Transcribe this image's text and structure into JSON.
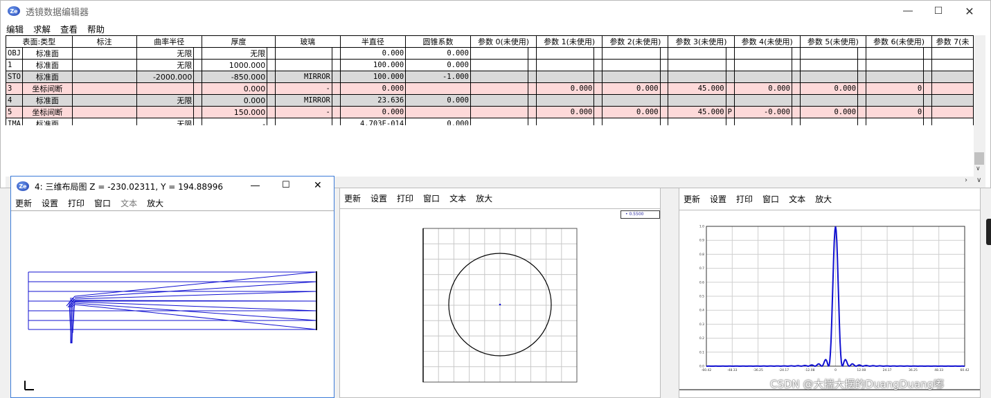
{
  "main": {
    "title": "透镜数据编辑器",
    "menu": [
      "编辑",
      "求解",
      "查看",
      "帮助"
    ],
    "columns": [
      "表面:类型",
      "标注",
      "曲率半径",
      "厚度",
      "玻璃",
      "半直径",
      "圆锥系数",
      "参数 0(未使用)",
      "参数 1(未使用)",
      "参数 2(未使用)",
      "参数 3(未使用)",
      "参数 4(未使用)",
      "参数 5(未使用)",
      "参数 6(未使用)",
      "参数 7(未"
    ],
    "rows": [
      {
        "id": "OBJ",
        "type": "标准面",
        "radius": "无限",
        "thickness": "无限",
        "glass": "",
        "semidia": "0.000",
        "conic": "0.000",
        "p1": "",
        "p2": "",
        "p3": "",
        "p4f": "",
        "p4": "",
        "p5": "",
        "p6": "",
        "style": ""
      },
      {
        "id": "1",
        "type": "标准面",
        "radius": "无限",
        "thickness": "1000.000",
        "glass": "",
        "semidia": "100.000",
        "conic": "0.000",
        "p1": "",
        "p2": "",
        "p3": "",
        "p4f": "",
        "p4": "",
        "p5": "",
        "p6": "",
        "style": ""
      },
      {
        "id": "STO",
        "type": "标准面",
        "radius": "-2000.000",
        "thickness": "-850.000",
        "glass": "MIRROR",
        "semidia": "100.000",
        "conic": "-1.000",
        "p1": "",
        "p2": "",
        "p3": "",
        "p4f": "",
        "p4": "",
        "p5": "",
        "p6": "",
        "style": "gray"
      },
      {
        "id": "3",
        "type": "坐标间断",
        "radius": "",
        "thickness": "0.000",
        "glass": "-",
        "semidia": "0.000",
        "conic": "",
        "p1": "0.000",
        "p2": "0.000",
        "p3": "45.000",
        "p4f": "",
        "p4": "0.000",
        "p5": "0.000",
        "p6": "0",
        "style": "pink"
      },
      {
        "id": "4",
        "type": "标准面",
        "radius": "无限",
        "thickness": "0.000",
        "glass": "MIRROR",
        "semidia": "23.636",
        "conic": "0.000",
        "p1": "",
        "p2": "",
        "p3": "",
        "p4f": "",
        "p4": "",
        "p5": "",
        "p6": "",
        "style": "gray"
      },
      {
        "id": "5",
        "type": "坐标间断",
        "radius": "",
        "thickness": "150.000",
        "glass": "-",
        "semidia": "0.000",
        "conic": "",
        "p1": "0.000",
        "p2": "0.000",
        "p3": "45.000",
        "p4f": "P",
        "p4": "-0.000",
        "p5": "0.000",
        "p6": "0",
        "style": "pink"
      },
      {
        "id": "IMA",
        "type": "标准面",
        "radius": "无限",
        "thickness": "-",
        "glass": "",
        "semidia": "4.703E-014",
        "conic": "0.000",
        "p1": "",
        "p2": "",
        "p3": "",
        "p4f": "",
        "p4": "",
        "p5": "",
        "p6": "",
        "style": ""
      }
    ]
  },
  "layout3d": {
    "title": "4: 三维布局图 Z = -230.02311, Y = 194.88996",
    "menu": [
      "更新",
      "设置",
      "打印",
      "窗口",
      "文本",
      "放大"
    ]
  },
  "spot": {
    "menu": [
      "更新",
      "设置",
      "打印",
      "窗口",
      "文本",
      "放大"
    ],
    "legend": "0.5500"
  },
  "psf": {
    "menu": [
      "更新",
      "设置",
      "打印",
      "窗口",
      "文本",
      "放大"
    ],
    "y_ticks": [
      "1.0",
      "0.9",
      "0.8",
      "0.7",
      "0.6",
      "0.5",
      "0.4",
      "0.3",
      "0.2",
      "0.1",
      "0.0"
    ],
    "x_ticks": [
      "-60.42",
      "-48.33",
      "-36.25",
      "-24.17",
      "-12.08",
      "0",
      "12.08",
      "24.17",
      "36.25",
      "48.33",
      "60.42"
    ]
  },
  "watermark": "CSDN @大揣大摆的DuangDuang嘟",
  "colors": {
    "ray": "#1010d0",
    "pink_row": "#fdd9d9",
    "gray_row": "#d9d9d9"
  }
}
